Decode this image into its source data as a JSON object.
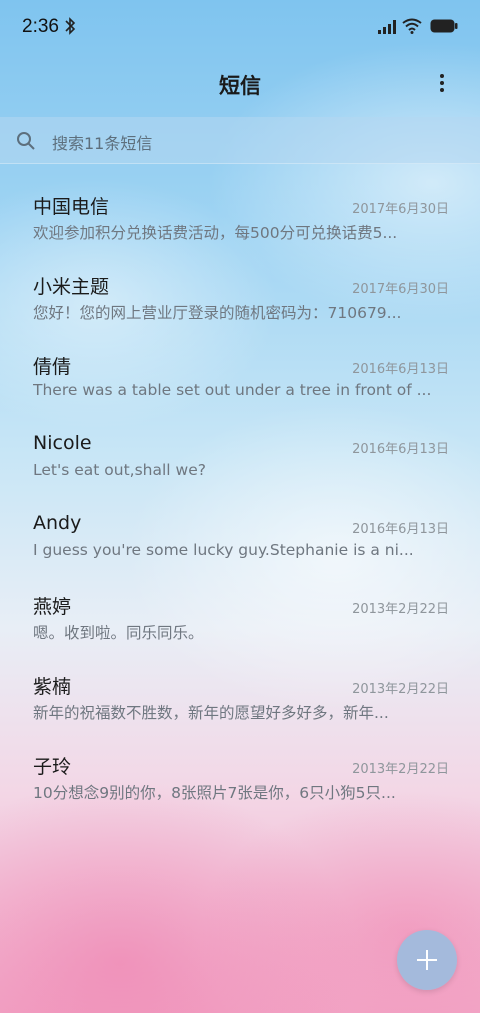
{
  "status_bar": {
    "time": "2:36",
    "icons": [
      "bluetooth-icon",
      "signal-icon",
      "wifi-icon",
      "battery-icon"
    ]
  },
  "header": {
    "title": "短信",
    "menu_icon": "more-vertical-icon"
  },
  "search": {
    "placeholder": "搜索11条短信",
    "icon": "search-icon"
  },
  "messages": [
    {
      "name": "中国电信",
      "date": "2017年6月30日",
      "preview": "欢迎参加积分兑换话费活动，每500分可兑换话费5..."
    },
    {
      "name": "小米主题",
      "date": "2017年6月30日",
      "preview": "您好！您的网上营业厅登录的随机密码为：710679..."
    },
    {
      "name": "倩倩",
      "date": "2016年6月13日",
      "preview": "There was a table set out under a tree in front of ..."
    },
    {
      "name": "Nicole",
      "date": "2016年6月13日",
      "preview": "Let's eat out,shall we?"
    },
    {
      "name": "Andy",
      "date": "2016年6月13日",
      "preview": "I guess you're some lucky guy.Stephanie is a ni..."
    },
    {
      "name": "燕婷",
      "date": "2013年2月22日",
      "preview": "嗯。收到啦。同乐同乐。"
    },
    {
      "name": "紫楠",
      "date": "2013年2月22日",
      "preview": "新年的祝福数不胜数，新年的愿望好多好多，新年..."
    },
    {
      "name": "子玲",
      "date": "2013年2月22日",
      "preview": "10分想念9别的你，8张照片7张是你，6只小狗5只..."
    }
  ],
  "fab": {
    "icon": "plus-icon"
  }
}
